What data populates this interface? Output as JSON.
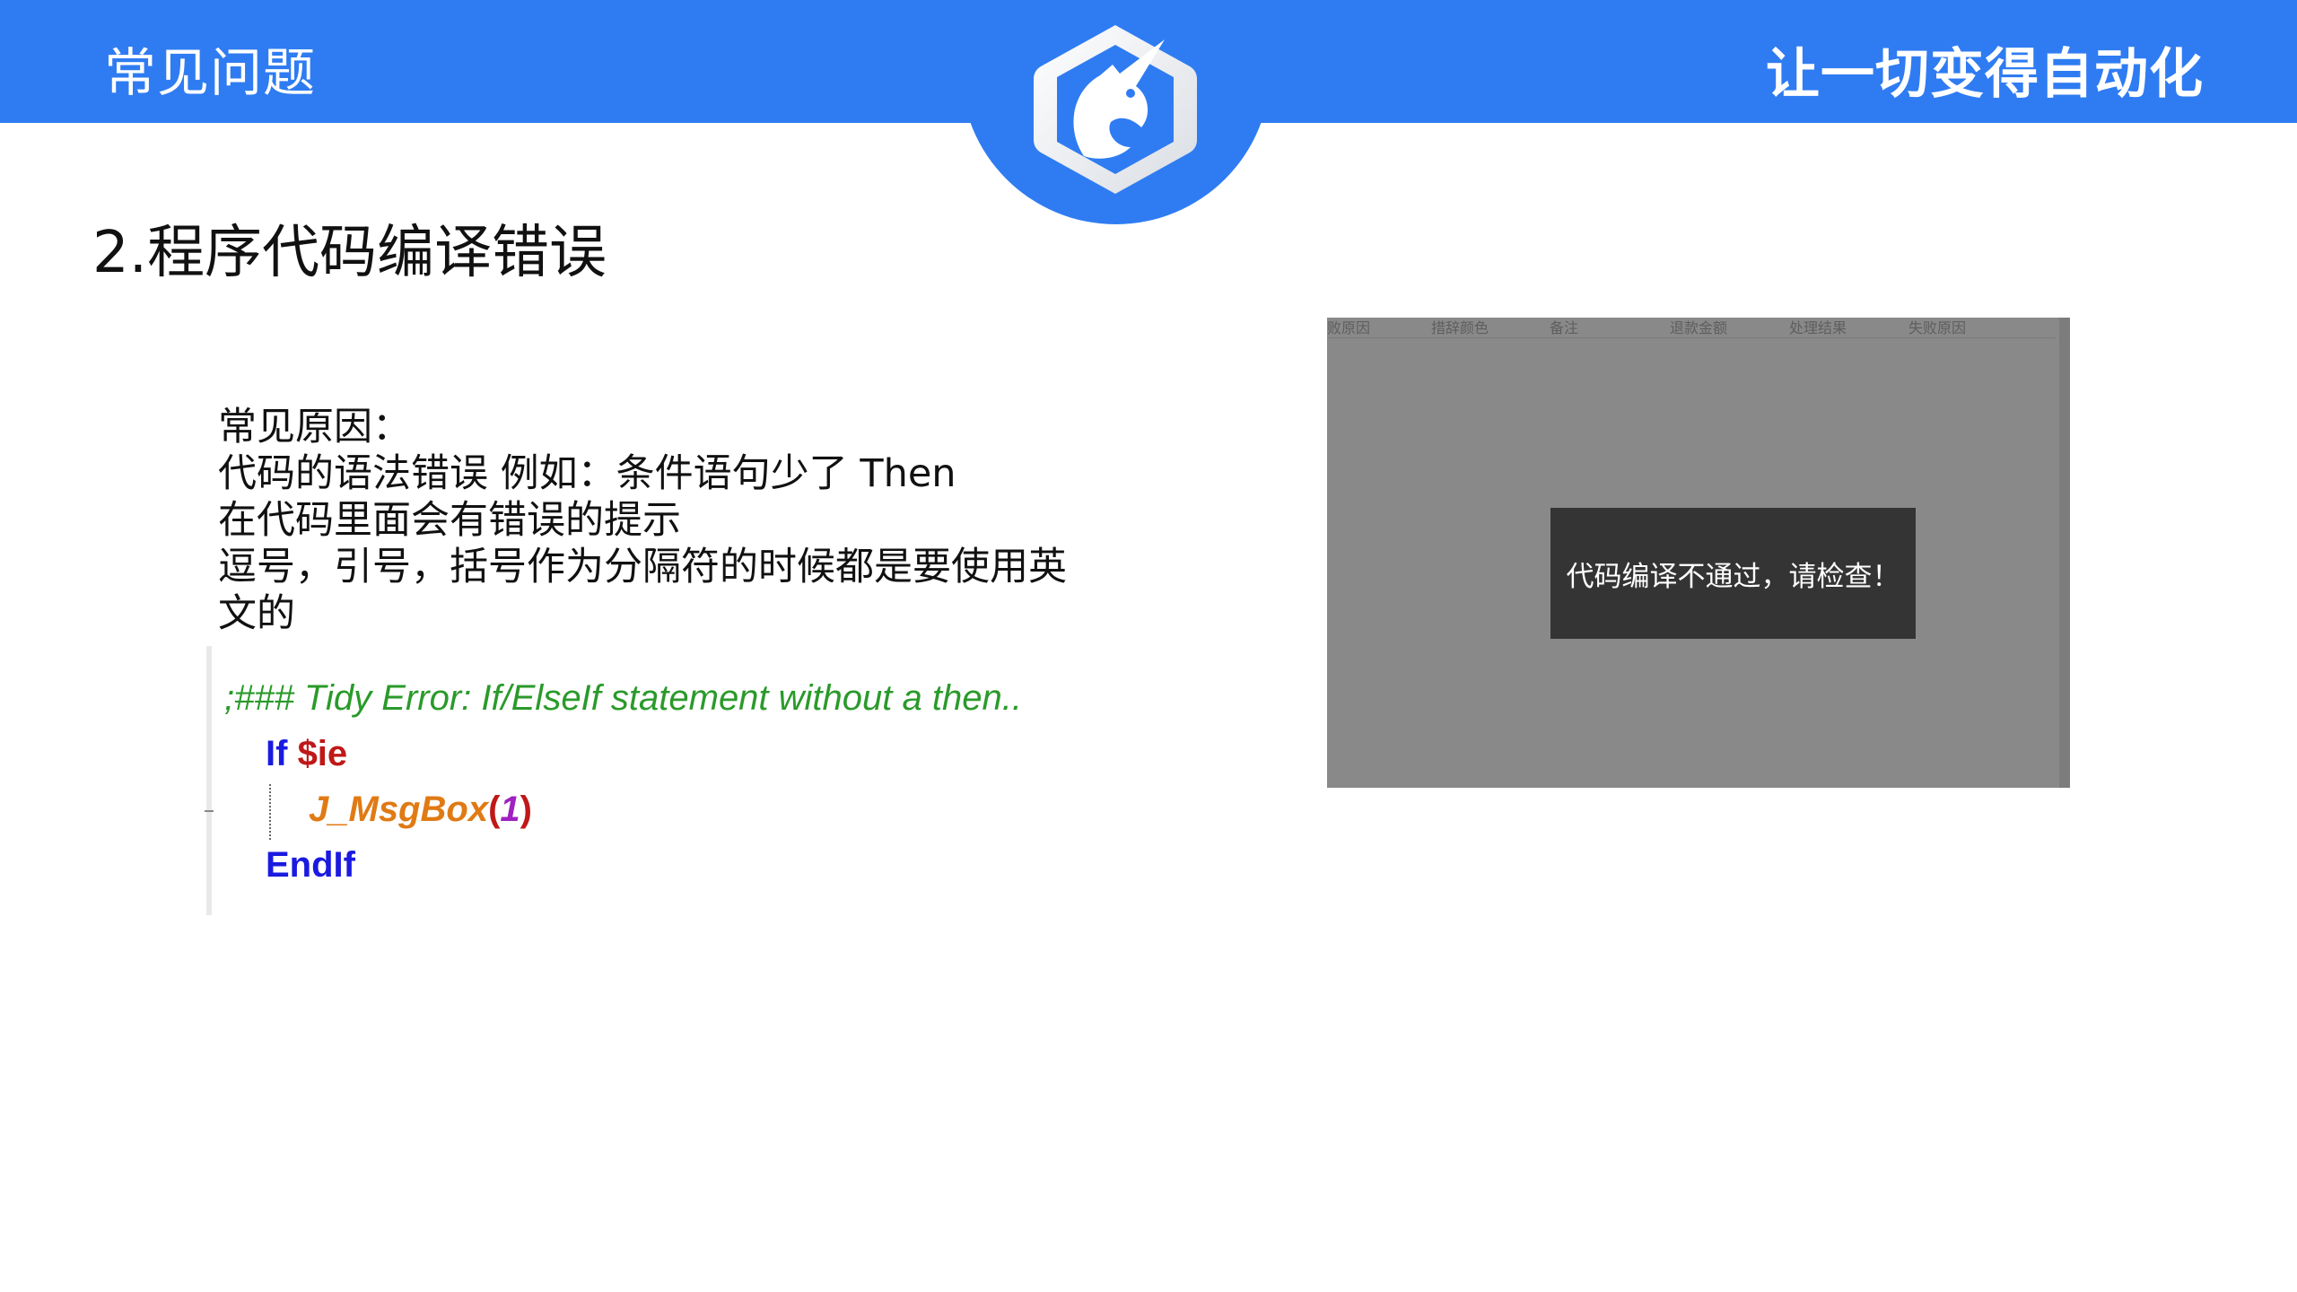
{
  "header": {
    "left_title": "常见问题",
    "right_slogan": "让一切变得自动化",
    "logo_icon": "unicorn-hexagon-logo",
    "brand_color": "#2f7cf2"
  },
  "section": {
    "title": "2.程序代码编译错误"
  },
  "reasons": {
    "lines": [
      "常见原因：",
      "代码的语法错误 例如：条件语句少了 Then",
      "在代码里面会有错误的提示",
      "逗号，引号，括号作为分隔符的时候都是要使用英",
      "文的"
    ]
  },
  "code": {
    "comment": ";### Tidy Error: If/ElseIf statement without a then..",
    "if_kw": "If",
    "if_var": "$ie",
    "func_name": "J_MsgBox",
    "paren_open": "(",
    "arg": "1",
    "paren_close": ")",
    "endif_kw": "EndIf"
  },
  "screenshot": {
    "columns": [
      "败原因",
      "措辞颜色",
      "备注",
      "退款金额",
      "处理结果",
      "失败原因"
    ],
    "toast_message": "代码编译不通过，请检查！"
  }
}
